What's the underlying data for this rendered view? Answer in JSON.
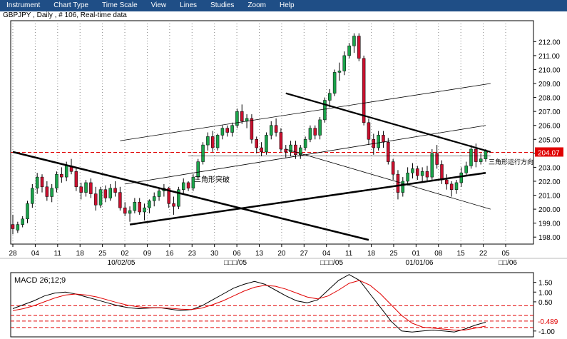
{
  "menu": [
    "Instrument",
    "Chart Type",
    "Time Scale",
    "View",
    "Lines",
    "Studies",
    "Zoom",
    "Help"
  ],
  "subtitle": "GBPJPY , Daily , # 106, Real-time data",
  "colors": {
    "menubar": "#1f4e86",
    "up": "#1aa34a",
    "down": "#c8102e",
    "macd": "#000000",
    "signal": "#e00000",
    "hline": "#e00000"
  },
  "chart_data": [
    {
      "type": "candlestick",
      "title": "GBPJPY , Daily , # 106, Real-time data",
      "ylim": [
        197.5,
        213.5
      ],
      "y_ticks": [
        "212.00",
        "211.00",
        "210.00",
        "209.00",
        "208.00",
        "207.00",
        "206.00",
        "205.00",
        "204.00",
        "203.00",
        "202.00",
        "201.00",
        "200.00",
        "199.00",
        "198.00"
      ],
      "x_ticks": [
        "28",
        "04",
        "11",
        "18",
        "25",
        "02",
        "09",
        "16",
        "23",
        "30",
        "06",
        "13",
        "20",
        "27",
        "04",
        "11",
        "18",
        "25",
        "01",
        "08",
        "15",
        "22",
        "05"
      ],
      "x_sublabels": [
        "10/02/05",
        "□□□/05",
        "□□□/05",
        "01/01/06",
        "□□/06"
      ],
      "hline": {
        "value": 204.07,
        "label": "204.07"
      },
      "annotations": [
        "三角形突破",
        "三角形运行方向"
      ],
      "candles": [
        [
          198.9,
          199.6,
          198.2,
          198.6
        ],
        [
          198.5,
          199.1,
          198.3,
          198.9
        ],
        [
          198.9,
          199.5,
          198.7,
          199.3
        ],
        [
          199.3,
          200.6,
          199.0,
          200.4
        ],
        [
          200.4,
          201.8,
          200.1,
          201.5
        ],
        [
          201.5,
          202.6,
          201.1,
          202.3
        ],
        [
          202.3,
          202.5,
          201.2,
          201.6
        ],
        [
          201.6,
          202.0,
          200.6,
          200.9
        ],
        [
          200.9,
          201.8,
          200.5,
          201.5
        ],
        [
          201.5,
          202.7,
          201.2,
          202.5
        ],
        [
          202.5,
          203.0,
          201.9,
          202.3
        ],
        [
          202.3,
          203.4,
          202.0,
          203.1
        ],
        [
          203.1,
          203.6,
          202.5,
          202.7
        ],
        [
          202.7,
          203.0,
          201.3,
          201.6
        ],
        [
          201.6,
          201.9,
          200.7,
          201.2
        ],
        [
          201.2,
          202.1,
          200.9,
          201.9
        ],
        [
          201.9,
          202.2,
          200.8,
          201.1
        ],
        [
          201.1,
          201.6,
          199.9,
          200.3
        ],
        [
          200.3,
          201.6,
          200.1,
          201.4
        ],
        [
          201.4,
          201.7,
          200.5,
          200.8
        ],
        [
          200.8,
          201.8,
          200.6,
          201.5
        ],
        [
          201.5,
          202.0,
          200.9,
          201.2
        ],
        [
          201.2,
          201.6,
          199.9,
          200.1
        ],
        [
          200.1,
          200.5,
          199.5,
          199.7
        ],
        [
          199.7,
          200.2,
          199.1,
          199.9
        ],
        [
          199.9,
          200.8,
          199.7,
          200.5
        ],
        [
          200.5,
          200.8,
          199.6,
          199.8
        ],
        [
          199.8,
          200.4,
          199.2,
          200.1
        ],
        [
          200.1,
          200.7,
          199.7,
          200.6
        ],
        [
          200.6,
          201.2,
          200.2,
          200.9
        ],
        [
          200.9,
          201.5,
          200.6,
          201.3
        ],
        [
          201.3,
          201.8,
          200.9,
          201.5
        ],
        [
          201.5,
          201.6,
          200.1,
          200.4
        ],
        [
          200.4,
          200.9,
          199.6,
          200.2
        ],
        [
          200.2,
          201.6,
          200.0,
          201.4
        ],
        [
          201.4,
          202.2,
          201.1,
          201.9
        ],
        [
          201.9,
          202.0,
          201.3,
          201.5
        ],
        [
          201.5,
          202.5,
          201.3,
          202.3
        ],
        [
          202.3,
          203.6,
          202.1,
          203.4
        ],
        [
          203.4,
          204.8,
          203.2,
          204.6
        ],
        [
          204.6,
          205.5,
          204.2,
          205.2
        ],
        [
          205.2,
          205.6,
          204.1,
          204.4
        ],
        [
          204.4,
          205.4,
          204.2,
          205.3
        ],
        [
          205.3,
          206.0,
          205.0,
          205.8
        ],
        [
          205.8,
          206.0,
          205.2,
          205.5
        ],
        [
          205.5,
          206.2,
          205.2,
          206.0
        ],
        [
          206.0,
          207.2,
          205.8,
          207.0
        ],
        [
          207.0,
          207.5,
          206.1,
          206.3
        ],
        [
          206.3,
          206.8,
          205.8,
          206.5
        ],
        [
          206.5,
          206.8,
          204.7,
          205.0
        ],
        [
          205.0,
          205.2,
          204.0,
          204.4
        ],
        [
          204.4,
          204.8,
          203.8,
          204.1
        ],
        [
          204.1,
          205.5,
          203.9,
          205.3
        ],
        [
          205.3,
          206.3,
          205.0,
          206.0
        ],
        [
          206.0,
          206.5,
          205.2,
          205.5
        ],
        [
          205.5,
          205.8,
          204.1,
          204.3
        ],
        [
          204.3,
          204.6,
          203.7,
          204.1
        ],
        [
          204.1,
          204.9,
          203.8,
          204.6
        ],
        [
          204.6,
          204.9,
          203.6,
          203.9
        ],
        [
          203.9,
          204.6,
          203.6,
          204.4
        ],
        [
          204.4,
          205.2,
          204.2,
          205.0
        ],
        [
          205.0,
          206.0,
          204.8,
          205.8
        ],
        [
          205.8,
          206.0,
          205.0,
          205.3
        ],
        [
          205.3,
          206.6,
          205.0,
          206.4
        ],
        [
          206.4,
          208.0,
          206.2,
          207.8
        ],
        [
          207.8,
          208.6,
          207.3,
          208.3
        ],
        [
          208.3,
          210.0,
          208.1,
          209.8
        ],
        [
          209.8,
          210.5,
          209.2,
          209.9
        ],
        [
          209.9,
          211.3,
          209.6,
          211.0
        ],
        [
          211.0,
          211.9,
          210.8,
          211.7
        ],
        [
          211.7,
          212.6,
          211.2,
          212.4
        ],
        [
          212.4,
          212.6,
          210.6,
          210.8
        ],
        [
          210.8,
          211.0,
          206.0,
          206.2
        ],
        [
          206.2,
          206.5,
          204.6,
          205.0
        ],
        [
          205.0,
          205.4,
          203.9,
          204.4
        ],
        [
          204.4,
          205.6,
          204.2,
          205.3
        ],
        [
          205.3,
          205.6,
          204.4,
          204.8
        ],
        [
          204.8,
          205.1,
          203.2,
          203.4
        ],
        [
          203.4,
          203.6,
          202.1,
          202.5
        ],
        [
          202.5,
          202.8,
          200.7,
          201.2
        ],
        [
          201.2,
          202.3,
          200.9,
          202.0
        ],
        [
          202.0,
          203.0,
          201.7,
          202.6
        ],
        [
          202.6,
          203.3,
          202.2,
          202.9
        ],
        [
          202.9,
          203.1,
          202.1,
          202.4
        ],
        [
          202.4,
          203.0,
          201.9,
          202.7
        ],
        [
          202.7,
          203.1,
          202.0,
          202.3
        ],
        [
          202.3,
          204.3,
          202.1,
          204.0
        ],
        [
          204.0,
          204.6,
          202.9,
          203.2
        ],
        [
          203.2,
          203.5,
          201.8,
          202.1
        ],
        [
          202.1,
          202.5,
          201.4,
          201.8
        ],
        [
          201.8,
          202.0,
          200.9,
          201.4
        ],
        [
          201.4,
          202.1,
          201.1,
          201.9
        ],
        [
          201.9,
          203.0,
          201.6,
          202.6
        ],
        [
          202.6,
          203.4,
          202.4,
          203.1
        ],
        [
          203.1,
          204.6,
          202.9,
          204.3
        ],
        [
          204.3,
          204.7,
          203.0,
          203.4
        ],
        [
          203.4,
          204.0,
          203.2,
          203.6
        ],
        [
          203.6,
          204.3,
          203.4,
          204.2
        ]
      ],
      "trendlines_note": "multiple triangle trendlines as shown"
    },
    {
      "type": "line",
      "title": "MACD 26;12;9",
      "ylim": [
        -1.3,
        2.0
      ],
      "y_ticks": [
        "1.50",
        "1.00",
        "0.50",
        "-1.00"
      ],
      "hlines": [
        {
          "value": -0.489,
          "label": "-0.489"
        },
        0.3,
        -0.2,
        -0.82
      ],
      "series": [
        {
          "name": "MACD",
          "values": [
            0.15,
            0.35,
            0.55,
            0.8,
            0.95,
            1.0,
            0.9,
            0.75,
            0.6,
            0.45,
            0.3,
            0.2,
            0.15,
            0.18,
            0.2,
            0.12,
            0.05,
            0.1,
            0.3,
            0.6,
            0.9,
            1.2,
            1.4,
            1.55,
            1.4,
            1.1,
            0.8,
            0.55,
            0.45,
            0.6,
            1.1,
            1.6,
            1.9,
            1.6,
            0.9,
            0.2,
            -0.5,
            -1.0,
            -1.05,
            -1.0,
            -0.95,
            -1.0,
            -1.05,
            -0.9,
            -0.7,
            -0.55
          ]
        },
        {
          "name": "Signal",
          "values": [
            0.05,
            0.15,
            0.3,
            0.5,
            0.7,
            0.85,
            0.9,
            0.85,
            0.75,
            0.6,
            0.45,
            0.32,
            0.24,
            0.2,
            0.2,
            0.17,
            0.12,
            0.1,
            0.18,
            0.35,
            0.55,
            0.8,
            1.05,
            1.25,
            1.35,
            1.3,
            1.15,
            0.95,
            0.75,
            0.65,
            0.8,
            1.1,
            1.45,
            1.6,
            1.35,
            0.9,
            0.35,
            -0.2,
            -0.6,
            -0.8,
            -0.85,
            -0.9,
            -0.95,
            -0.95,
            -0.85,
            -0.75
          ]
        }
      ]
    }
  ]
}
